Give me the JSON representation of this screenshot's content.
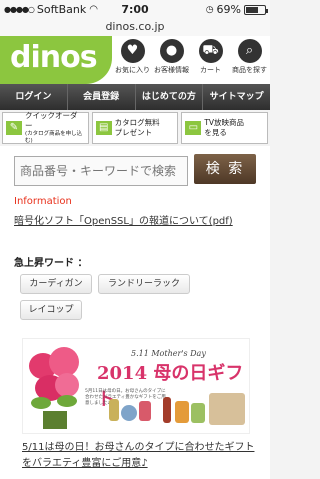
{
  "status_bar": {
    "carrier": "SoftBank",
    "time": "7:00",
    "battery": "69%",
    "battery_level": 0.69
  },
  "browser": {
    "url": "dinos.co.jp"
  },
  "header": {
    "logo": "dinos",
    "icons": [
      {
        "label": "お気に入り",
        "icon": "heart-icon",
        "glyph": "♥"
      },
      {
        "label": "お客様情報",
        "icon": "person-icon",
        "glyph": "●"
      },
      {
        "label": "カート",
        "icon": "cart-icon",
        "glyph": "⛟"
      },
      {
        "label": "商品を探す",
        "icon": "search-icon",
        "glyph": "⌕"
      }
    ]
  },
  "nav": [
    "ログイン",
    "会員登録",
    "はじめての方",
    "サイトマップ"
  ],
  "shortcuts": [
    {
      "title": "クイックオーダー",
      "sub": "(カタログ商品を申し込む)",
      "icon": "order-icon"
    },
    {
      "title": "カタログ無料",
      "sub": "プレゼント",
      "icon": "catalog-icon"
    },
    {
      "title": "TV放映商品",
      "sub": "を見る",
      "icon": "tv-icon"
    }
  ],
  "search": {
    "placeholder": "商品番号・キーワードで検索",
    "button": "検 索"
  },
  "information": {
    "title": "Information",
    "link": "暗号化ソフト「OpenSSL」の報道について(pdf)"
  },
  "keywords": {
    "title": "急上昇ワード ：",
    "items": [
      "カーディガン",
      "ランドリーラック",
      "レイコップ"
    ]
  },
  "banner": {
    "subtitle": "5.11 Mother's Day",
    "title": "2014 母の日ギフト",
    "fine_print": "5月11日は母の日。お母さんのタイプに合わせたバラエティ豊かなギフトをご用意しました♪",
    "caption": "5/11は母の日！お母さんのタイプに合わせたギフトをバラエティ豊富にご用意♪"
  },
  "colors": {
    "brand_green": "#8cc63f",
    "nav_dark": "#333333",
    "search_button": "#6a5039",
    "info_red": "#e8311c",
    "banner_pink": "#d8336a"
  }
}
